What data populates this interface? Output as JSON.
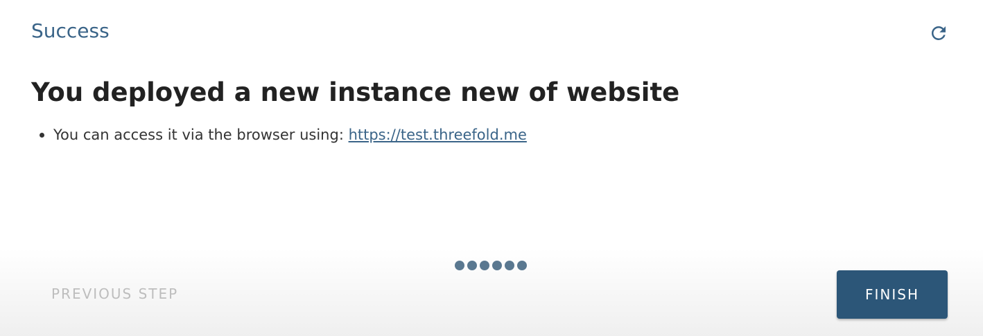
{
  "card": {
    "title": "Success",
    "refresh_icon": "refresh-icon"
  },
  "content": {
    "heading": "You deployed a new instance new of website",
    "bullets": [
      {
        "text": "You can access it via the browser using: ",
        "link": "https://test.threefold.me"
      }
    ]
  },
  "stepper": {
    "total_steps": 6,
    "step_icon": "step-dot"
  },
  "footer": {
    "previous_label": "PREVIOUS STEP",
    "finish_label": "FINISH"
  },
  "colors": {
    "accent": "#3a6488",
    "primary_button": "#2c5678",
    "disabled_text": "#bdbdbd",
    "dots": "#5a7890"
  }
}
